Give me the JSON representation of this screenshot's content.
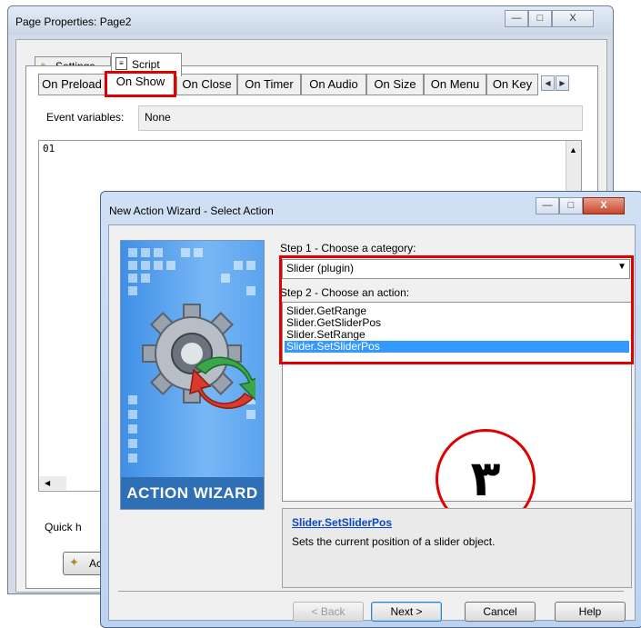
{
  "background_window": {
    "title": "Page Properties: Page2",
    "caption_buttons": {
      "minimize": "—",
      "maximize": "□",
      "close": "X"
    },
    "tabs": [
      {
        "label": "Settings"
      },
      {
        "label": "Script"
      }
    ],
    "event_tabs": [
      "On Preload",
      "On Show",
      "On Close",
      "On Timer",
      "On Audio",
      "On Size",
      "On Menu",
      "On Key"
    ],
    "selected_event_tab": "On Show",
    "event_variables_label": "Event variables:",
    "event_variables_value": "None",
    "code_line": "01",
    "quick_help_label": "Quick h",
    "action_button_label": "Ac"
  },
  "dialog": {
    "title": "New Action Wizard - Select Action",
    "art_label": "ACTION WIZARD",
    "step1_label": "Step 1 - Choose a category:",
    "category_selected": "Slider (plugin)",
    "step2_label": "Step 2 - Choose an action:",
    "actions": [
      "Slider.GetRange",
      "Slider.GetSliderPos",
      "Slider.SetRange",
      "Slider.SetSliderPos"
    ],
    "selected_action": "Slider.SetSliderPos",
    "description_title": "Slider.SetSliderPos",
    "description_text": "Sets the current position of a slider object.",
    "buttons": {
      "back": "< Back",
      "next": "Next >",
      "cancel": "Cancel",
      "help": "Help"
    },
    "annotation_number": "٣"
  },
  "colors": {
    "highlight_red": "#e10000",
    "selection_blue": "#3399ff",
    "link_blue": "#0b46c8"
  }
}
